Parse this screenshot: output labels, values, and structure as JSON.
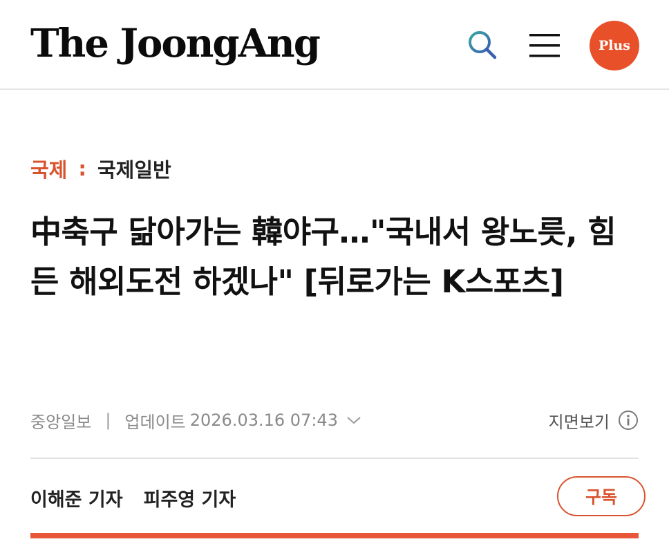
{
  "header": {
    "logo_text": "The JoongAng",
    "search_icon": "search-icon",
    "menu_icon": "hamburger-menu-icon",
    "plus_label": "Plus"
  },
  "breadcrumb": {
    "section": "국제",
    "separator": ":",
    "subsection": "국제일반"
  },
  "article": {
    "headline": "中축구 닮아가는 韓야구…\"국내서 왕노릇, 힘든 해외도전 하겠나\" [뒤로가는 K스포츠]",
    "source": "중앙일보",
    "meta_separator": "|",
    "update_label": "업데이트",
    "update_datetime": "2026.03.16 07:43",
    "print_view_label": "지면보기",
    "reporters": [
      "이해준 기자",
      "피주영 기자"
    ],
    "subscribe_label": "구독"
  },
  "colors": {
    "brand_accent": "#e8502a",
    "section_text": "#d9532e",
    "logo_text": "#0b0b0b",
    "search_icon_teal": "#2f8f9d",
    "search_icon_blue": "#3a5fb0"
  }
}
